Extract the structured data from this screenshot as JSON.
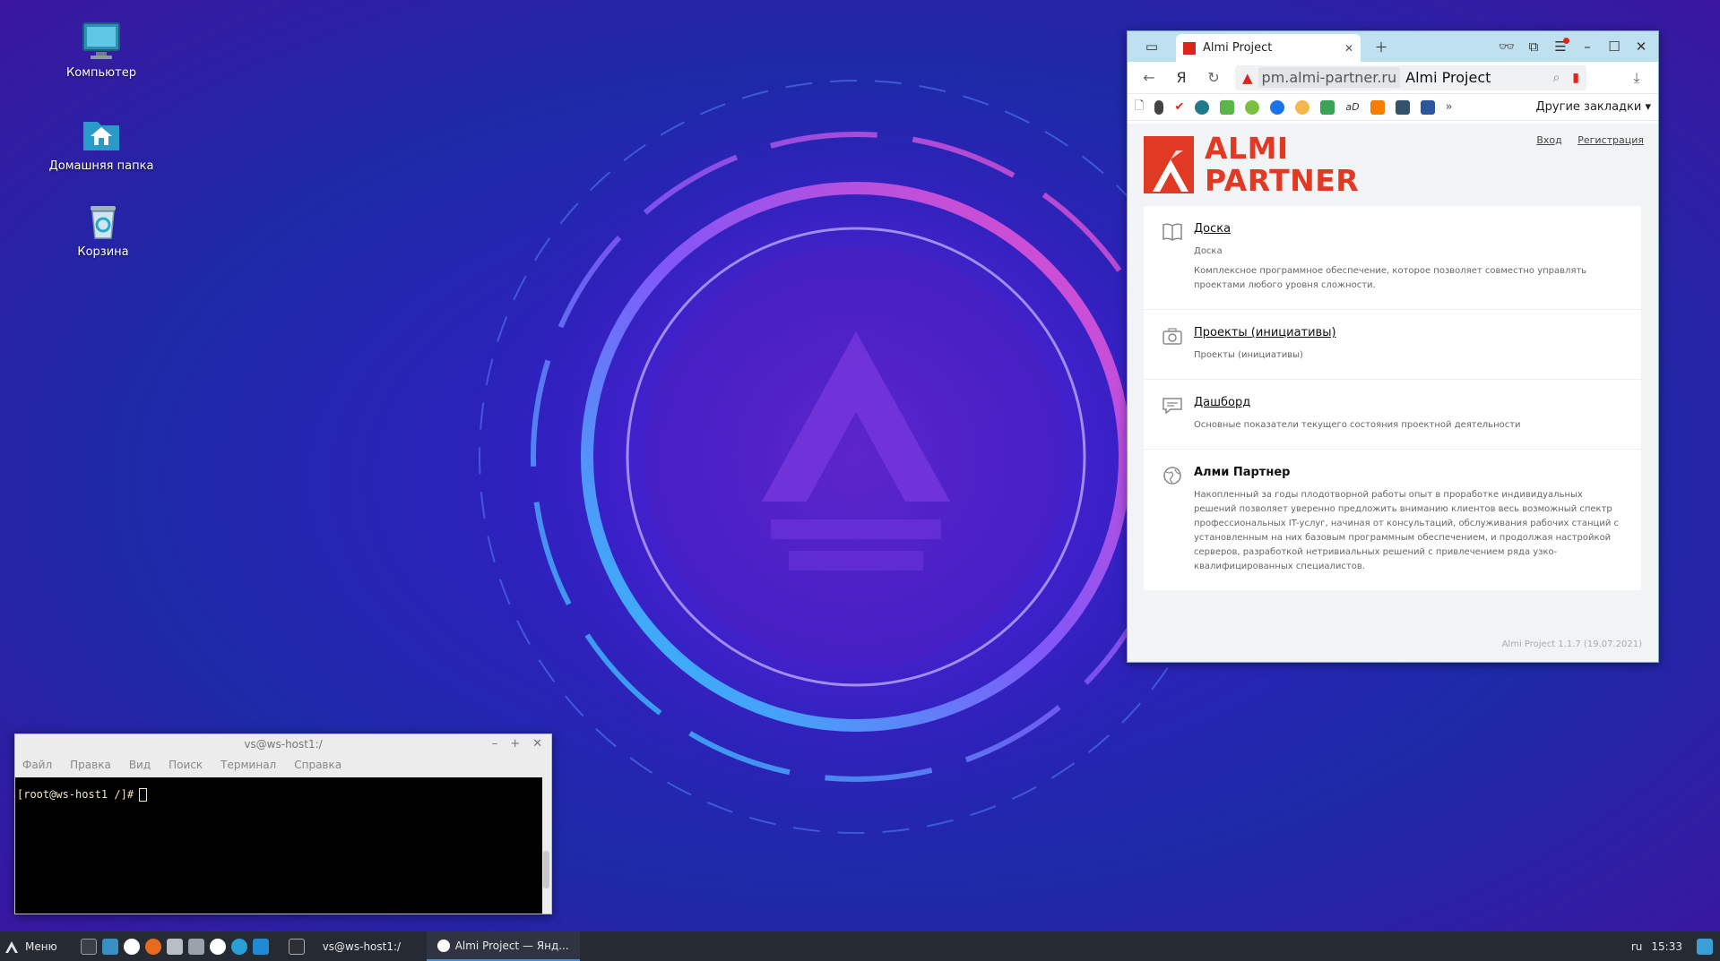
{
  "desktop": {
    "icons": [
      {
        "label": "Компьютер",
        "icon": "computer-icon"
      },
      {
        "label": "Домашняя папка",
        "icon": "home-folder-icon"
      },
      {
        "label": "Корзина",
        "icon": "trash-icon"
      }
    ]
  },
  "browser": {
    "tab": {
      "title": "Almi Project"
    },
    "address": {
      "host": "pm.almi-partner.ru",
      "title": "Almi Project"
    },
    "bookmarks_other": "Другие закладки",
    "page": {
      "logo_line1": "ALMI",
      "logo_line2": "PARTNER",
      "login": "Вход",
      "register": "Регистрация",
      "cards": [
        {
          "title": "Доска",
          "subtitle": "Доска",
          "description": "Комплексное программное обеспечение, которое позволяет совместно управлять проектами любого уровня сложности.",
          "icon": "book-icon"
        },
        {
          "title": "Проекты (инициативы)",
          "subtitle": "Проекты (инициативы)",
          "description": "",
          "icon": "camera-icon"
        },
        {
          "title": "Дашборд",
          "subtitle": "Основные показатели текущего состояния проектной деятельности",
          "description": "",
          "icon": "comment-icon"
        },
        {
          "title": "Алми Партнер",
          "subtitle": "",
          "description": "Накопленный за годы плодотворной работы опыт в проработке индивидуальных решений позволяет уверенно предложить вниманию клиентов весь возможный спектр профессиональных IT-услуг, начиная от консультаций, обслуживания рабочих станций с установленным на них базовым программным обеспечением, и продолжая настройкой серверов, разработкой нетривиальных решений с привлечением ряда узко-квалифицированных специалистов.",
          "icon": "globe-icon"
        }
      ],
      "version": "Almi Project 1.1.7 (19.07.2021)"
    }
  },
  "terminal": {
    "title": "vs@ws-host1:/",
    "menu": [
      "Файл",
      "Правка",
      "Вид",
      "Поиск",
      "Терминал",
      "Справка"
    ],
    "prompt": "[root@ws-host1 /]#"
  },
  "taskbar": {
    "menu_label": "Меню",
    "tasks": [
      {
        "label": "vs@ws-host1:/"
      },
      {
        "label": "Almi Project — Янд..."
      }
    ],
    "lang": "ru",
    "clock": "15:33"
  },
  "colors": {
    "brand_red": "#e03a24",
    "browser_chrome": "#bfe0ee",
    "taskbar": "#262a33"
  }
}
